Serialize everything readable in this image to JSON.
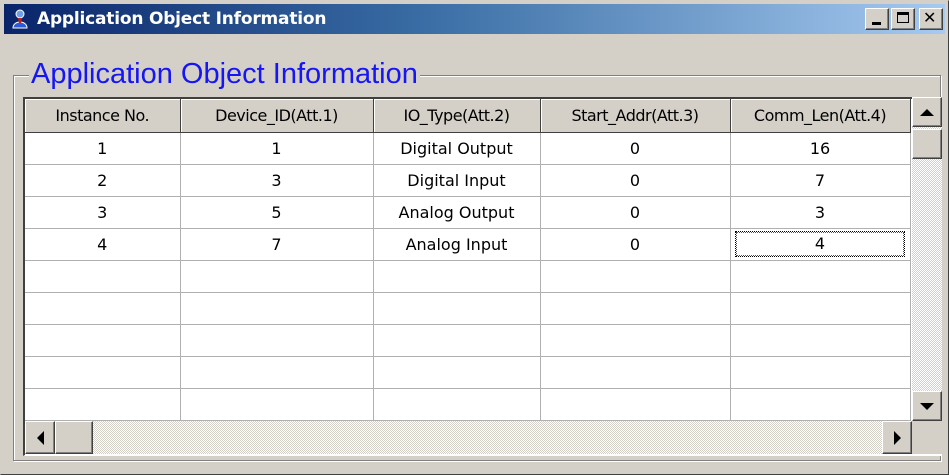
{
  "window": {
    "title": "Application Object Information",
    "icon": "app-user-icon",
    "controls": [
      "minimize-icon",
      "maximize-icon",
      "close-icon"
    ]
  },
  "group": {
    "title": "Application Object Information",
    "title_color": "#1515f5"
  },
  "table": {
    "columns": [
      "Instance No.",
      "Device_ID(Att.1)",
      "IO_Type(Att.2)",
      "Start_Addr(Att.3)",
      "Comm_Len(Att.4)"
    ],
    "rows": [
      [
        "1",
        "1",
        "Digital Output",
        "0",
        "16"
      ],
      [
        "2",
        "3",
        "Digital Input",
        "0",
        "7"
      ],
      [
        "3",
        "5",
        "Analog  Output",
        "0",
        "3"
      ],
      [
        "4",
        "7",
        "Analog  Input",
        "0",
        "4"
      ]
    ],
    "focused_cell": "row 4, Comm_Len(Att.4)"
  },
  "colors": {
    "titlebar_start": "#0a246a",
    "titlebar_end": "#a6caf0",
    "face": "#d4d0c8"
  }
}
